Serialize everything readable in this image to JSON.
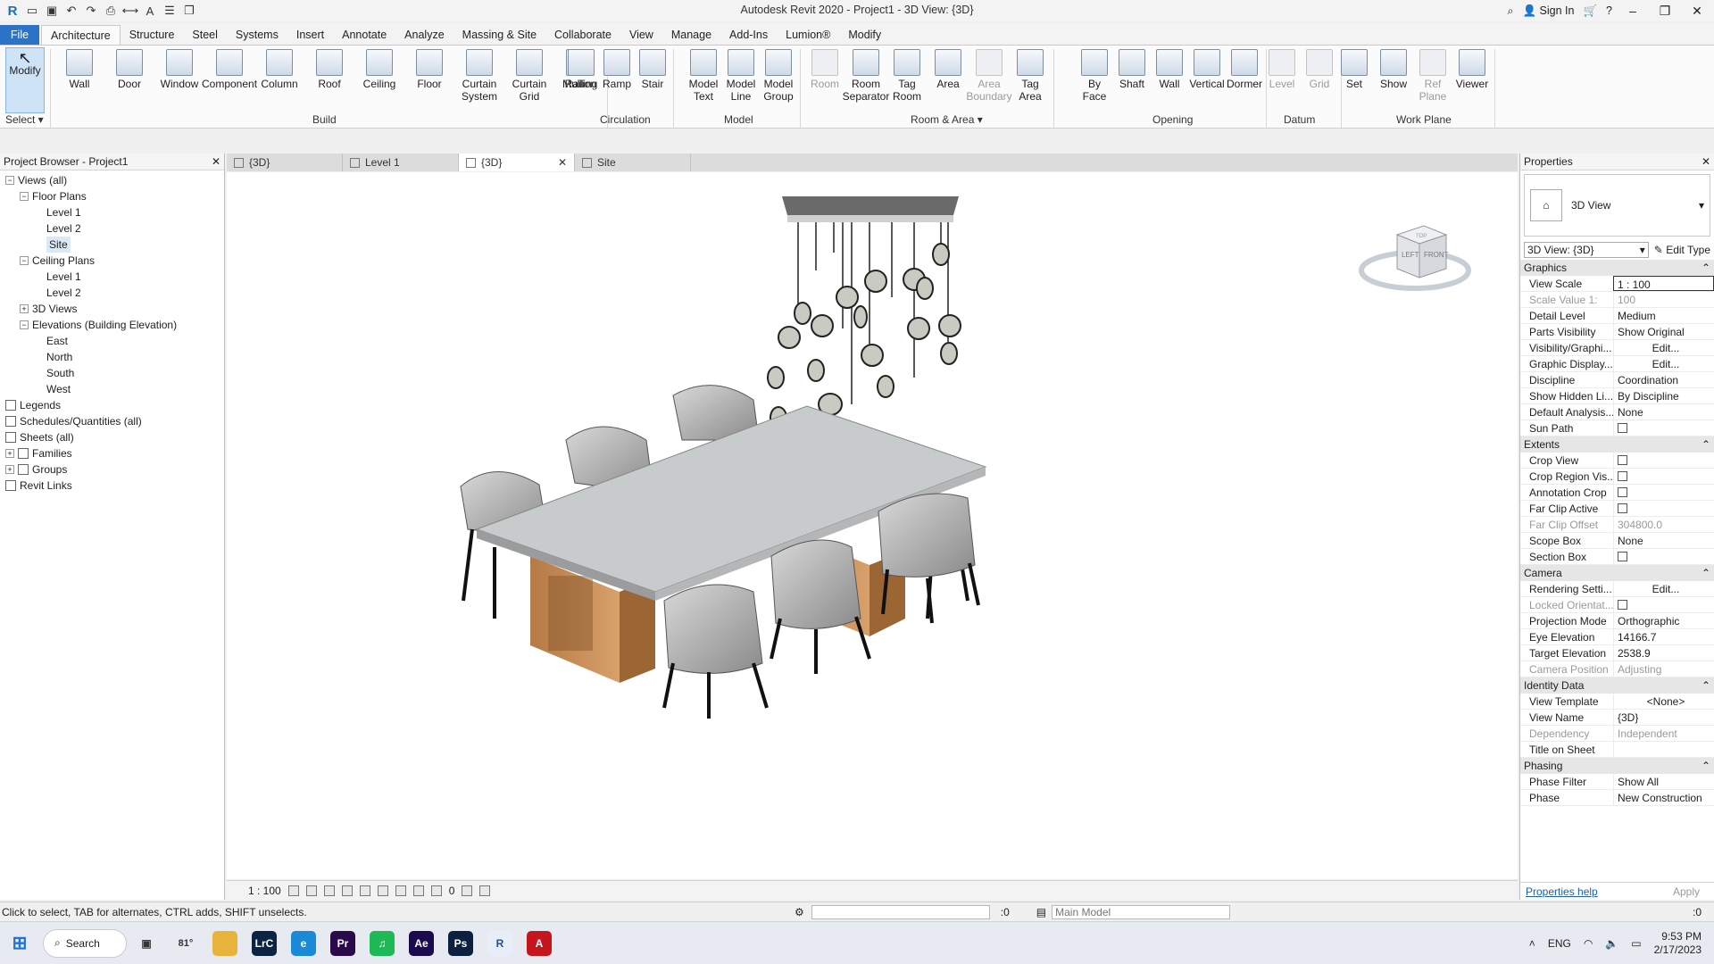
{
  "window": {
    "title": "Autodesk Revit 2020 - Project1 - 3D View: {3D}",
    "sign_in": "Sign In"
  },
  "ribbon_tabs": [
    "File",
    "Architecture",
    "Structure",
    "Steel",
    "Systems",
    "Insert",
    "Annotate",
    "Analyze",
    "Massing & Site",
    "Collaborate",
    "View",
    "Manage",
    "Add-Ins",
    "Lumion®",
    "Modify"
  ],
  "ribbon": {
    "modify": "Modify",
    "select": "Select ▾",
    "build": {
      "label": "Build",
      "items": [
        "Wall",
        "Door",
        "Window",
        "Component",
        "Column",
        "Roof",
        "Ceiling",
        "Floor",
        "Curtain System",
        "Curtain Grid",
        "Mullion"
      ]
    },
    "circulation": {
      "label": "Circulation",
      "items": [
        "Railing",
        "Ramp",
        "Stair"
      ]
    },
    "model": {
      "label": "Model",
      "items": [
        "Model Text",
        "Model Line",
        "Model Group"
      ]
    },
    "room_area": {
      "label": "Room & Area ▾",
      "items": [
        "Room",
        "Room Separator",
        "Tag Room",
        "Area",
        "Area Boundary",
        "Tag Area"
      ]
    },
    "opening": {
      "label": "Opening",
      "items": [
        "By Face",
        "Shaft",
        "Wall",
        "Vertical",
        "Dormer"
      ]
    },
    "datum": {
      "label": "Datum",
      "items": [
        "Level",
        "Grid"
      ]
    },
    "work_plane": {
      "label": "Work Plane",
      "items": [
        "Set",
        "Show",
        "Ref Plane",
        "Viewer"
      ]
    }
  },
  "project_browser": {
    "title": "Project Browser - Project1",
    "tree": [
      {
        "label": "Views (all)",
        "level": 0,
        "exp": "−"
      },
      {
        "label": "Floor Plans",
        "level": 1,
        "exp": "−"
      },
      {
        "label": "Level 1",
        "level": 2
      },
      {
        "label": "Level 2",
        "level": 2
      },
      {
        "label": "Site",
        "level": 2,
        "selected": true
      },
      {
        "label": "Ceiling Plans",
        "level": 1,
        "exp": "−"
      },
      {
        "label": "Level 1",
        "level": 2
      },
      {
        "label": "Level 2",
        "level": 2
      },
      {
        "label": "3D Views",
        "level": 1,
        "exp": "+"
      },
      {
        "label": "Elevations (Building Elevation)",
        "level": 1,
        "exp": "−"
      },
      {
        "label": "East",
        "level": 2
      },
      {
        "label": "North",
        "level": 2
      },
      {
        "label": "South",
        "level": 2
      },
      {
        "label": "West",
        "level": 2
      },
      {
        "label": "Legends",
        "level": 0,
        "icon": true
      },
      {
        "label": "Schedules/Quantities (all)",
        "level": 0,
        "icon": true
      },
      {
        "label": "Sheets (all)",
        "level": 0,
        "icon": true
      },
      {
        "label": "Families",
        "level": 0,
        "exp": "+",
        "icon": true
      },
      {
        "label": "Groups",
        "level": 0,
        "exp": "+",
        "icon": true
      },
      {
        "label": "Revit Links",
        "level": 0,
        "icon": true
      }
    ]
  },
  "view_tabs": [
    {
      "label": "{3D}",
      "active": false
    },
    {
      "label": "Level 1",
      "active": false
    },
    {
      "label": "{3D}",
      "active": true
    },
    {
      "label": "Site",
      "active": false
    }
  ],
  "viewcube": {
    "left": "LEFT",
    "front": "FRONT",
    "top": "TOP"
  },
  "view_control": {
    "scale": "1 : 100",
    "count": "0"
  },
  "properties": {
    "title": "Properties",
    "type_name": "3D View",
    "instance": "3D View: {3D}",
    "edit_type": "Edit Type",
    "groups": [
      {
        "name": "Graphics",
        "rows": [
          {
            "name": "View Scale",
            "value": "1 : 100",
            "style": "boxed"
          },
          {
            "name": "Scale Value    1:",
            "value": "100",
            "dim": true
          },
          {
            "name": "Detail Level",
            "value": "Medium"
          },
          {
            "name": "Parts Visibility",
            "value": "Show Original"
          },
          {
            "name": "Visibility/Graphi...",
            "value": "Edit...",
            "style": "btn"
          },
          {
            "name": "Graphic Display...",
            "value": "Edit...",
            "style": "btn"
          },
          {
            "name": "Discipline",
            "value": "Coordination"
          },
          {
            "name": "Show Hidden Li...",
            "value": "By Discipline"
          },
          {
            "name": "Default Analysis...",
            "value": "None"
          },
          {
            "name": "Sun Path",
            "value": "",
            "checkbox": true
          }
        ]
      },
      {
        "name": "Extents",
        "rows": [
          {
            "name": "Crop View",
            "value": "",
            "checkbox": true
          },
          {
            "name": "Crop Region Vis...",
            "value": "",
            "checkbox": true
          },
          {
            "name": "Annotation Crop",
            "value": "",
            "checkbox": true
          },
          {
            "name": "Far Clip Active",
            "value": "",
            "checkbox": true
          },
          {
            "name": "Far Clip Offset",
            "value": "304800.0",
            "dim": true
          },
          {
            "name": "Scope Box",
            "value": "None"
          },
          {
            "name": "Section Box",
            "value": "",
            "checkbox": true
          }
        ]
      },
      {
        "name": "Camera",
        "rows": [
          {
            "name": "Rendering Setti...",
            "value": "Edit...",
            "style": "btn"
          },
          {
            "name": "Locked Orientat...",
            "value": "",
            "checkbox": true,
            "dim": true
          },
          {
            "name": "Projection Mode",
            "value": "Orthographic"
          },
          {
            "name": "Eye Elevation",
            "value": "14166.7"
          },
          {
            "name": "Target Elevation",
            "value": "2538.9"
          },
          {
            "name": "Camera Position",
            "value": "Adjusting",
            "dim": true
          }
        ]
      },
      {
        "name": "Identity Data",
        "rows": [
          {
            "name": "View Template",
            "value": "<None>",
            "style": "btn"
          },
          {
            "name": "View Name",
            "value": "{3D}"
          },
          {
            "name": "Dependency",
            "value": "Independent",
            "dim": true
          },
          {
            "name": "Title on Sheet",
            "value": ""
          }
        ]
      },
      {
        "name": "Phasing",
        "rows": [
          {
            "name": "Phase Filter",
            "value": "Show All"
          },
          {
            "name": "Phase",
            "value": "New Construction"
          }
        ]
      }
    ],
    "help": "Properties help",
    "apply": "Apply"
  },
  "statusbar": {
    "text": "Click to select, TAB for alternates, CTRL adds, SHIFT unselects.",
    "count": ":0",
    "main_model": "Main Model",
    "filter_count": ":0"
  },
  "taskbar": {
    "search": "Search",
    "weather": "81°",
    "language": "ENG",
    "time": "9:53 PM",
    "date": "2/17/2023",
    "apps": [
      {
        "name": "file-explorer-icon",
        "color": "#e8b33b",
        "glyph": ""
      },
      {
        "name": "lightroom-classic-icon",
        "color": "#0c2343",
        "glyph": "LrC"
      },
      {
        "name": "edge-icon",
        "color": "#1a8ad6",
        "glyph": "e"
      },
      {
        "name": "premiere-pro-icon",
        "color": "#2a0a4a",
        "glyph": "Pr"
      },
      {
        "name": "spotify-icon",
        "color": "#1db954",
        "glyph": "♫"
      },
      {
        "name": "after-effects-icon",
        "color": "#1c0a4f",
        "glyph": "Ae"
      },
      {
        "name": "photoshop-icon",
        "color": "#0c1f3e",
        "glyph": "Ps"
      },
      {
        "name": "revit-icon",
        "color": "#e8eef7",
        "glyph": "R"
      },
      {
        "name": "autocad-icon",
        "color": "#c4161c",
        "glyph": "A"
      }
    ]
  }
}
